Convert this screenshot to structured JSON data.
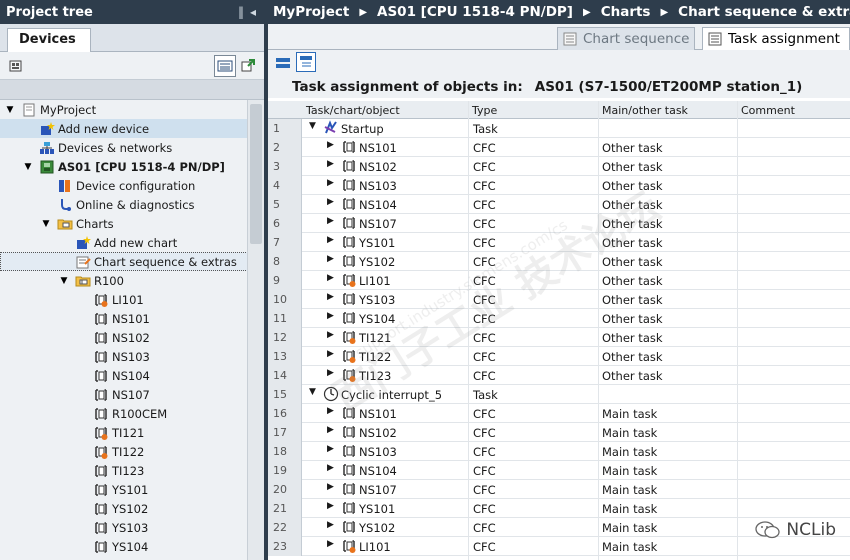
{
  "left_panel": {
    "title": "Project tree",
    "title_controls": [
      "‖",
      "◂"
    ],
    "devices_tab": "Devices",
    "tree": [
      {
        "label": "MyProject",
        "icon": "project-icon",
        "indent": 0,
        "twisty": "open"
      },
      {
        "label": "Add new device",
        "icon": "add-device-icon",
        "indent": 1,
        "twisty": "",
        "highlight": true
      },
      {
        "label": "Devices & networks",
        "icon": "network-icon",
        "indent": 1,
        "twisty": ""
      },
      {
        "label": "AS01 [CPU 1518-4 PN/DP]",
        "icon": "cpu-icon",
        "indent": 1,
        "twisty": "open",
        "bold": true
      },
      {
        "label": "Device configuration",
        "icon": "device-config-icon",
        "indent": 2,
        "twisty": ""
      },
      {
        "label": "Online & diagnostics",
        "icon": "diagnostics-icon",
        "indent": 2,
        "twisty": ""
      },
      {
        "label": "Charts",
        "icon": "folder-icon",
        "indent": 2,
        "twisty": "open"
      },
      {
        "label": "Add new chart",
        "icon": "add-chart-icon",
        "indent": 3,
        "twisty": ""
      },
      {
        "label": "Chart sequence & extras",
        "icon": "chart-sequence-icon",
        "indent": 3,
        "twisty": "",
        "selected": true
      },
      {
        "label": "R100",
        "icon": "unit-folder-icon",
        "indent": 3,
        "twisty": "open"
      },
      {
        "label": "LI101",
        "icon": "cfc-orange-icon",
        "indent": 4,
        "twisty": ""
      },
      {
        "label": "NS101",
        "icon": "cfc-icon",
        "indent": 4,
        "twisty": ""
      },
      {
        "label": "NS102",
        "icon": "cfc-icon",
        "indent": 4,
        "twisty": ""
      },
      {
        "label": "NS103",
        "icon": "cfc-icon",
        "indent": 4,
        "twisty": ""
      },
      {
        "label": "NS104",
        "icon": "cfc-icon",
        "indent": 4,
        "twisty": ""
      },
      {
        "label": "NS107",
        "icon": "cfc-icon",
        "indent": 4,
        "twisty": ""
      },
      {
        "label": "R100CEM",
        "icon": "cfc-icon",
        "indent": 4,
        "twisty": ""
      },
      {
        "label": "TI121",
        "icon": "cfc-orange-icon",
        "indent": 4,
        "twisty": ""
      },
      {
        "label": "TI122",
        "icon": "cfc-orange-icon",
        "indent": 4,
        "twisty": ""
      },
      {
        "label": "TI123",
        "icon": "cfc-icon",
        "indent": 4,
        "twisty": ""
      },
      {
        "label": "YS101",
        "icon": "cfc-icon",
        "indent": 4,
        "twisty": ""
      },
      {
        "label": "YS102",
        "icon": "cfc-icon",
        "indent": 4,
        "twisty": ""
      },
      {
        "label": "YS103",
        "icon": "cfc-icon",
        "indent": 4,
        "twisty": ""
      },
      {
        "label": "YS104",
        "icon": "cfc-icon",
        "indent": 4,
        "twisty": ""
      }
    ]
  },
  "editor": {
    "breadcrumb": [
      "MyProject",
      "AS01 [CPU 1518-4 PN/DP]",
      "Charts",
      "Chart sequence & extras"
    ],
    "tabs": {
      "chart_sequence": "Chart sequence",
      "task_assignment": "Task assignment"
    },
    "heading_label": "Task assignment of objects in:",
    "heading_value": "AS01 (S7-1500/ET200MP station_1)",
    "columns": [
      "Task/chart/object",
      "Type",
      "Main/other task",
      "Comment"
    ],
    "rows": [
      {
        "num": "1",
        "name": "Startup",
        "type": "Task",
        "task": "",
        "kind": "task-startup"
      },
      {
        "num": "2",
        "name": "NS101",
        "type": "CFC",
        "task": "Other task",
        "kind": "cfc"
      },
      {
        "num": "3",
        "name": "NS102",
        "type": "CFC",
        "task": "Other task",
        "kind": "cfc"
      },
      {
        "num": "4",
        "name": "NS103",
        "type": "CFC",
        "task": "Other task",
        "kind": "cfc"
      },
      {
        "num": "5",
        "name": "NS104",
        "type": "CFC",
        "task": "Other task",
        "kind": "cfc"
      },
      {
        "num": "6",
        "name": "NS107",
        "type": "CFC",
        "task": "Other task",
        "kind": "cfc"
      },
      {
        "num": "7",
        "name": "YS101",
        "type": "CFC",
        "task": "Other task",
        "kind": "cfc"
      },
      {
        "num": "8",
        "name": "YS102",
        "type": "CFC",
        "task": "Other task",
        "kind": "cfc"
      },
      {
        "num": "9",
        "name": "LI101",
        "type": "CFC",
        "task": "Other task",
        "kind": "cfc-orange"
      },
      {
        "num": "10",
        "name": "YS103",
        "type": "CFC",
        "task": "Other task",
        "kind": "cfc"
      },
      {
        "num": "11",
        "name": "YS104",
        "type": "CFC",
        "task": "Other task",
        "kind": "cfc"
      },
      {
        "num": "12",
        "name": "TI121",
        "type": "CFC",
        "task": "Other task",
        "kind": "cfc-orange"
      },
      {
        "num": "13",
        "name": "TI122",
        "type": "CFC",
        "task": "Other task",
        "kind": "cfc-orange"
      },
      {
        "num": "14",
        "name": "TI123",
        "type": "CFC",
        "task": "Other task",
        "kind": "cfc-orange"
      },
      {
        "num": "15",
        "name": "Cyclic interrupt_5",
        "type": "Task",
        "task": "",
        "kind": "task-cyclic"
      },
      {
        "num": "16",
        "name": "NS101",
        "type": "CFC",
        "task": "Main task",
        "kind": "cfc"
      },
      {
        "num": "17",
        "name": "NS102",
        "type": "CFC",
        "task": "Main task",
        "kind": "cfc"
      },
      {
        "num": "18",
        "name": "NS103",
        "type": "CFC",
        "task": "Main task",
        "kind": "cfc"
      },
      {
        "num": "19",
        "name": "NS104",
        "type": "CFC",
        "task": "Main task",
        "kind": "cfc"
      },
      {
        "num": "20",
        "name": "NS107",
        "type": "CFC",
        "task": "Main task",
        "kind": "cfc"
      },
      {
        "num": "21",
        "name": "YS101",
        "type": "CFC",
        "task": "Main task",
        "kind": "cfc"
      },
      {
        "num": "22",
        "name": "YS102",
        "type": "CFC",
        "task": "Main task",
        "kind": "cfc"
      },
      {
        "num": "23",
        "name": "LI101",
        "type": "CFC",
        "task": "Main task",
        "kind": "cfc-orange"
      }
    ]
  },
  "watermark": {
    "text": "西门子工业  技术论坛",
    "url": "support.industry.siemens.com/cs"
  },
  "logo": {
    "text": "NCLib"
  },
  "colors": {
    "title_bar": "#2e3d4c",
    "panel_bg": "#eef1f4",
    "highlight_row": "#cfe0ee",
    "cfc_orange": "#e8731c"
  }
}
